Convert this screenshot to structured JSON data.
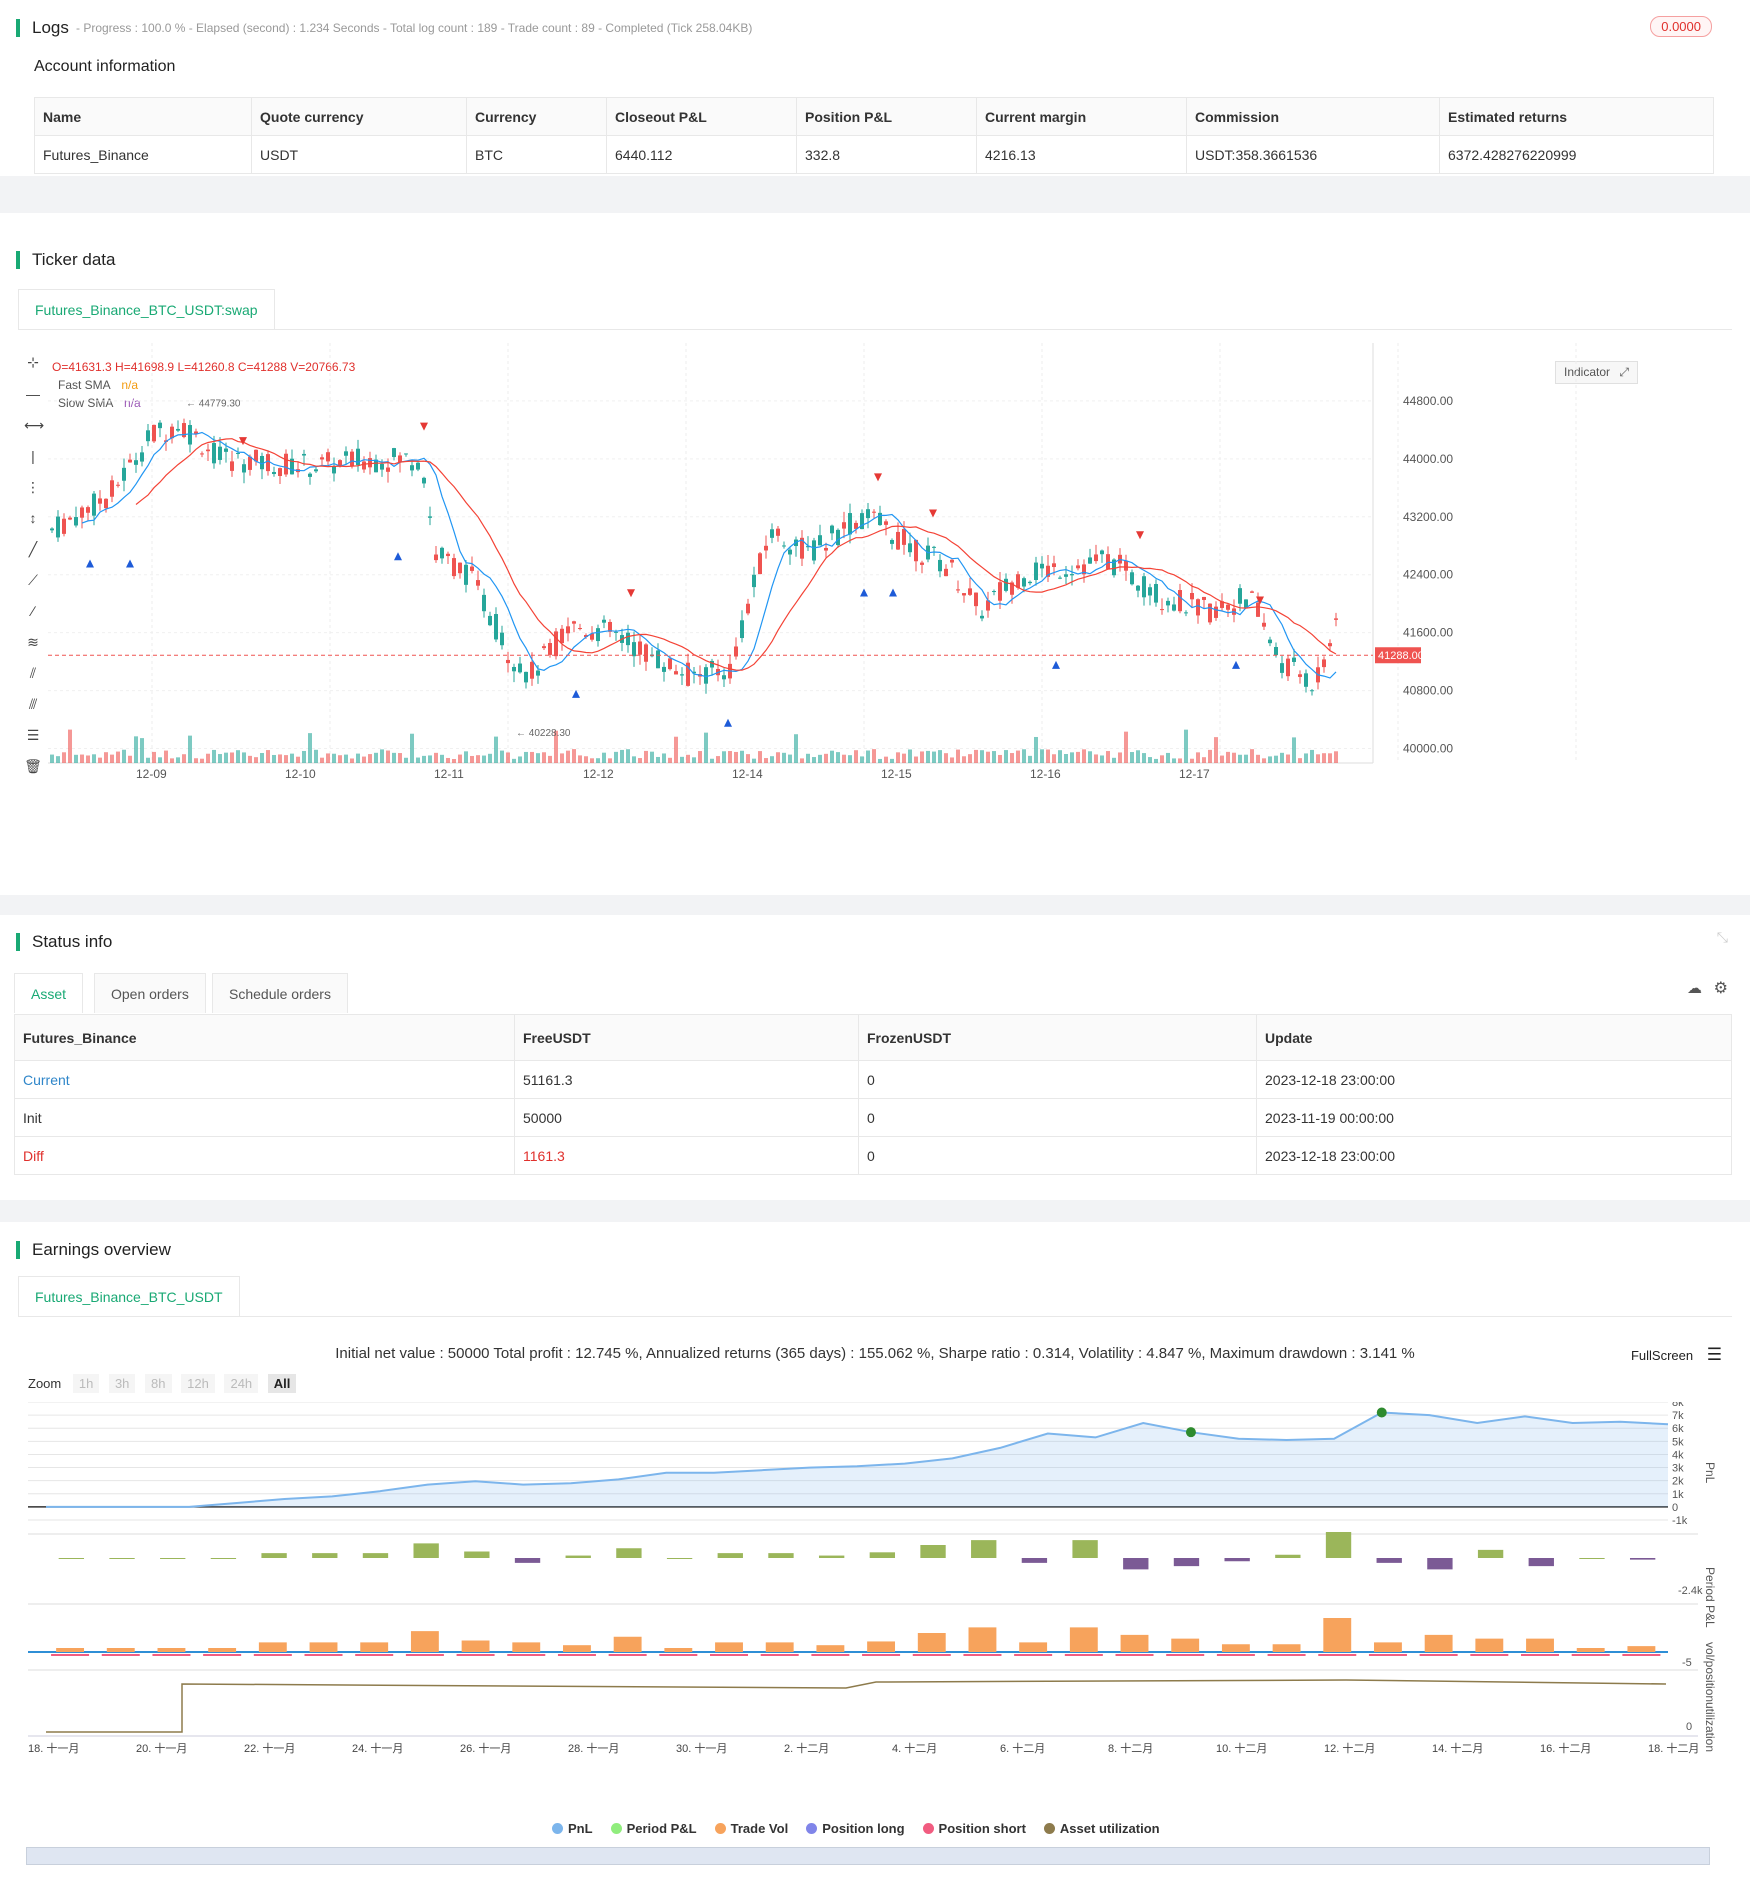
{
  "logs": {
    "title": "Logs",
    "summary": "- Progress : 100.0 % - Elapsed (second) : 1.234  Seconds - Total log count : 189 - Trade count : 89 - Completed (Tick 258.04KB)",
    "badge": "0.0000",
    "account_title": "Account information",
    "columns": [
      "Name",
      "Quote currency",
      "Currency",
      "Closeout P&L",
      "Position P&L",
      "Current margin",
      "Commission",
      "Estimated returns"
    ],
    "row": [
      "Futures_Binance",
      "USDT",
      "BTC",
      "6440.112",
      "332.8",
      "4216.13",
      "USDT:358.3661536",
      "6372.428276220999"
    ]
  },
  "ticker": {
    "title": "Ticker data",
    "tab": "Futures_Binance_BTC_USDT:swap",
    "ohlc": "O=41631.3 H=41698.9 L=41260.8 C=41288 V=20766.73",
    "fast_sma_label": "Fast SMA",
    "slow_sma_label": "Slow SMA",
    "na": "n/a",
    "indicator_btn": "Indicator",
    "price_ticks": [
      "44800.00",
      "44000.00",
      "43200.00",
      "42400.00",
      "41600.00",
      "40800.00",
      "40000.00"
    ],
    "date_ticks": [
      "12-09",
      "12-10",
      "12-11",
      "12-12",
      "12-14",
      "12-15",
      "12-16",
      "12-17"
    ],
    "current_price": "41288.00",
    "high_label": "44779.30",
    "low_label": "40228.30",
    "colors": {
      "up": "#26a69a",
      "down": "#ef5350",
      "fast": "#2196f3",
      "slow": "#f44336"
    }
  },
  "status": {
    "title": "Status info",
    "tabs": [
      "Asset",
      "Open orders",
      "Schedule orders"
    ],
    "columns": [
      "Futures_Binance",
      "FreeUSDT",
      "FrozenUSDT",
      "Update"
    ],
    "rows": [
      [
        "Current",
        "51161.3",
        "0",
        "2023-12-18 23:00:00"
      ],
      [
        "Init",
        "50000",
        "0",
        "2023-11-19 00:00:00"
      ],
      [
        "Diff",
        "1161.3",
        "0",
        "2023-12-18 23:00:00"
      ]
    ]
  },
  "earnings": {
    "title": "Earnings overview",
    "tab": "Futures_Binance_BTC_USDT",
    "summary": "Initial net value : 50000 Total profit : 12.745 %, Annualized returns (365 days) : 155.062 %, Sharpe ratio : 0.314, Volatility : 4.847 %, Maximum drawdown : 3.141 %",
    "fullscreen": "FullScreen",
    "zoom_label": "Zoom",
    "zoom_buttons": [
      "1h",
      "3h",
      "8h",
      "12h",
      "24h",
      "All"
    ],
    "pnl_ticks": [
      "8k",
      "7k",
      "6k",
      "5k",
      "4k",
      "3k",
      "2k",
      "1k",
      "0",
      "-1k"
    ],
    "period_tick": "-2.4k",
    "vol_tick": "-5",
    "util_tick": "0",
    "axis_titles": [
      "PnL",
      "Period P&L",
      "vol/position",
      "utilization"
    ],
    "date_ticks": [
      "18. 十一月",
      "20. 十一月",
      "22. 十一月",
      "24. 十一月",
      "26. 十一月",
      "28. 十一月",
      "30. 十一月",
      "2. 十二月",
      "4. 十二月",
      "6. 十二月",
      "8. 十二月",
      "10. 十二月",
      "12. 十二月",
      "14. 十二月",
      "16. 十二月",
      "18. 十二月"
    ],
    "legend": [
      {
        "name": "PnL",
        "color": "#7cb5ec"
      },
      {
        "name": "Period P&L",
        "color": "#90ed7d"
      },
      {
        "name": "Trade Vol",
        "color": "#f7a35c"
      },
      {
        "name": "Position long",
        "color": "#8085e9"
      },
      {
        "name": "Position short",
        "color": "#f15c80"
      },
      {
        "name": "Asset utilization",
        "color": "#8d7b4c"
      }
    ],
    "chart_data": {
      "type": "area",
      "pnl": [
        0,
        0,
        0,
        0,
        300,
        600,
        800,
        1200,
        1700,
        1950,
        1700,
        1800,
        2100,
        2600,
        2600,
        2800,
        3000,
        3100,
        3300,
        3700,
        4500,
        5600,
        5300,
        6400,
        5700,
        5200,
        5100,
        5200,
        7200,
        7000,
        6400,
        6900,
        6400,
        6500,
        6300
      ],
      "period": [
        0,
        0,
        0,
        0,
        300,
        300,
        300,
        900,
        400,
        -300,
        150,
        600,
        0,
        300,
        300,
        150,
        350,
        800,
        1100,
        -300,
        1100,
        -700,
        -500,
        -200,
        200,
        1600,
        -300,
        -700,
        500,
        -500,
        0,
        -100
      ],
      "ylim": [
        -1000,
        8000
      ]
    }
  }
}
